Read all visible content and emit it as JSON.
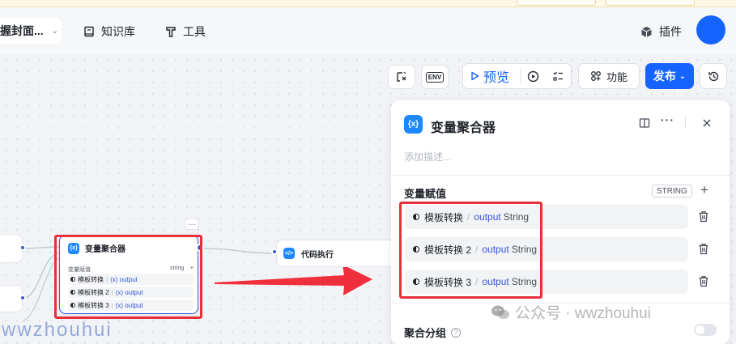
{
  "header": {
    "project_title": "握封面...",
    "nav": [
      {
        "label": "知识库",
        "icon": "book-icon"
      },
      {
        "label": "工具",
        "icon": "tool-icon"
      }
    ],
    "plugin_label": "插件"
  },
  "toolbar": {
    "env_label": "ENV",
    "preview_label": "预览",
    "features_label": "功能",
    "publish_label": "发布"
  },
  "canvas": {
    "agg_node": {
      "icon_text": "{x}",
      "title": "变量聚合器",
      "sub_left": "变量赋值",
      "sub_right": "string",
      "sub_plus": "+",
      "rows": [
        {
          "name": "模板转换",
          "var": "(x) output"
        },
        {
          "name": "模板转换 2",
          "var": "(x) output"
        },
        {
          "name": "模板转换 3",
          "var": "(x) output"
        }
      ],
      "more": "···"
    },
    "code_node": {
      "icon_text": "</>",
      "title": "代码执行"
    }
  },
  "panel": {
    "icon_text": "{x}",
    "title": "变量聚合器",
    "description_placeholder": "添加描述...",
    "section_title": "变量赋值",
    "type_tag": "STRING",
    "plus": "+",
    "variables": [
      {
        "node": "模板转换",
        "var": "output",
        "type": "String"
      },
      {
        "node": "模板转换 2",
        "var": "output",
        "type": "String"
      },
      {
        "node": "模板转换 3",
        "var": "output",
        "type": "String"
      }
    ],
    "group_label": "聚合分组",
    "help": "?"
  },
  "watermarks": {
    "wechat": "公众号 · wwzhouhui",
    "left": "wwzhouhui"
  },
  "colors": {
    "accent": "#1664ff",
    "annotation_red": "#e8303a",
    "node_blue": "#1e88ff"
  }
}
